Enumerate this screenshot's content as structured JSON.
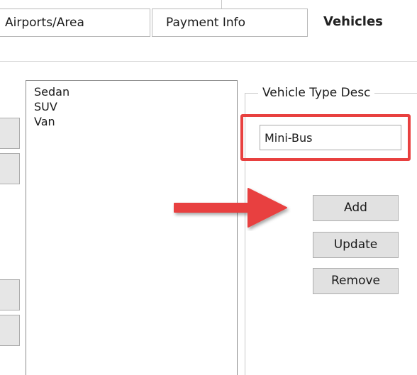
{
  "tabs": {
    "airports": "Airports/Area",
    "payment": "Payment Info",
    "vehicles": "Vehicles"
  },
  "vehicle_types": {
    "items": [
      "Sedan",
      "SUV",
      "Van"
    ]
  },
  "group": {
    "legend": "Vehicle Type Desc",
    "input_value": "Mini-Bus"
  },
  "buttons": {
    "add": "Add",
    "update": "Update",
    "remove": "Remove"
  },
  "colors": {
    "highlight": "#e8403f",
    "arrow": "#e8403f"
  },
  "icons": {
    "arrow": "arrow-right-icon"
  }
}
